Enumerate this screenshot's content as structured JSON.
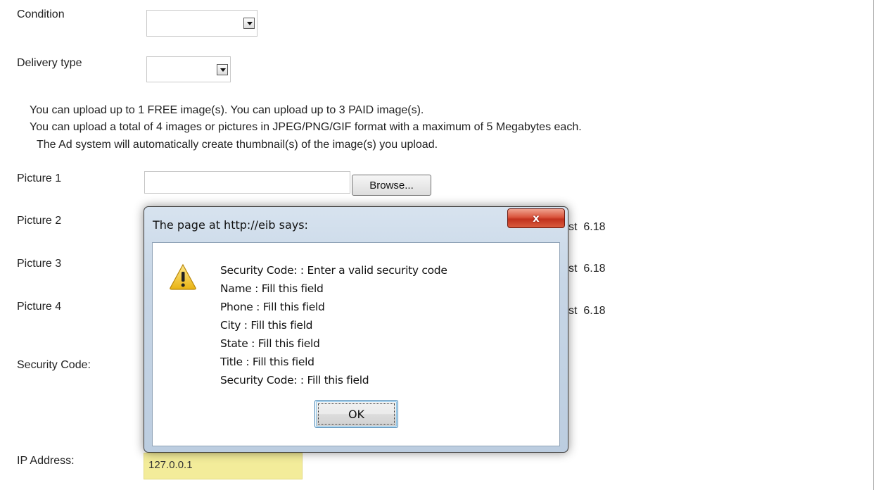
{
  "form": {
    "condition_label": "Condition",
    "delivery_label": "Delivery type",
    "upload_info": [
      "You can upload up to 1 FREE image(s).   You can upload up to 3 PAID image(s).",
      "You can upload a total of 4 images or pictures in JPEG/PNG/GIF format with a maximum of 5 Megabytes each.",
      "The Ad system will automatically create thumbnail(s) of the image(s) you upload."
    ],
    "pictures": [
      {
        "label": "Picture 1",
        "browse": "Browse..."
      },
      {
        "label": "Picture 2",
        "cost_prefix": "st",
        "cost_value": "6.18"
      },
      {
        "label": "Picture 3",
        "cost_prefix": "st",
        "cost_value": "6.18"
      },
      {
        "label": "Picture 4",
        "cost_prefix": "st",
        "cost_value": "6.18"
      }
    ],
    "security_label": "Security Code:",
    "ip_label": "IP Address:",
    "ip_value": "127.0.0.1"
  },
  "dialog": {
    "title": "The page at http://eib says:",
    "close_label": "x",
    "icon": "warning-icon",
    "messages": [
      "Security Code: : Enter a valid security code",
      "Name : Fill this field",
      "Phone : Fill this field",
      "City : Fill this field",
      "State : Fill this field",
      "Title : Fill this field",
      "Security Code: : Fill this field"
    ],
    "ok_label": "OK"
  },
  "colors": {
    "ip_highlight": "#f3ec9a",
    "close_button": "#c2321e",
    "dialog_frame": "#c7d6e6"
  }
}
